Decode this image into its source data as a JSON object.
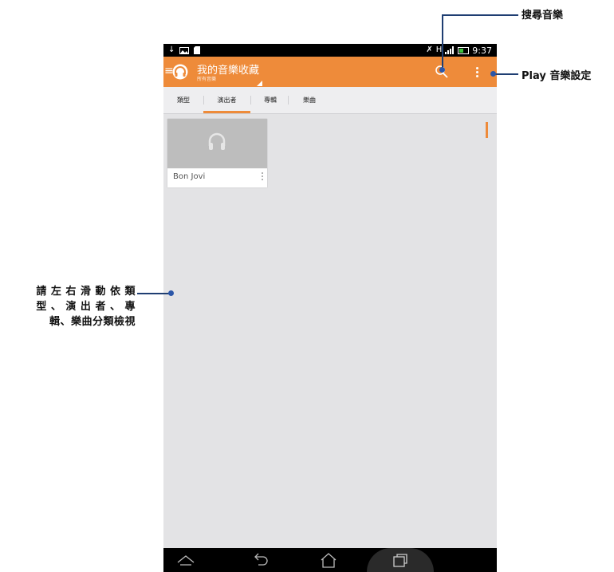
{
  "status_bar": {
    "time": "9:37",
    "left_icons": [
      "download-icon",
      "image-icon",
      "sd-card-icon"
    ],
    "right_icons": [
      "mute-icon",
      "signal-h-icon",
      "signal-bars-icon",
      "battery-icon"
    ]
  },
  "app_bar": {
    "title": "我的音樂收藏",
    "subtitle": "所有音樂",
    "actions": [
      "search-icon",
      "overflow-menu-icon"
    ]
  },
  "tabs": [
    {
      "label": "類型",
      "active": false
    },
    {
      "label": "演出者",
      "active": true
    },
    {
      "label": "專輯",
      "active": false
    },
    {
      "label": "樂曲",
      "active": false
    }
  ],
  "artists": [
    {
      "name": "Bon Jovi"
    }
  ],
  "nav_bar": [
    "back-icon",
    "home-icon",
    "recent-apps-icon"
  ],
  "annotations": {
    "search": "搜尋音樂",
    "settings": "Play 音樂設定",
    "swipe_line1": "請 左 右 滑 動 依 類",
    "swipe_line2": "型 、 演 出 者 、 專",
    "swipe_line3": "輯、樂曲分類檢視"
  },
  "colors": {
    "accent": "#ee8b3a",
    "callout_line": "#1f3e72"
  }
}
